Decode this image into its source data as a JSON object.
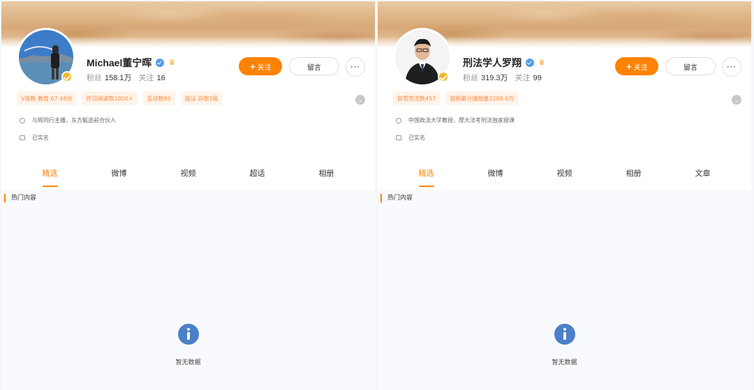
{
  "profiles": [
    {
      "name": "Michael董宁晖",
      "avatar_desc": "avatar",
      "stats": {
        "fans_label": "粉丝",
        "fans": "158.1万",
        "following_label": "关注",
        "following": "16"
      },
      "follow_label": "关注",
      "message_label": "留言",
      "more_label": "···",
      "tags": [
        "V指数 教育 67.48分",
        "昨日阅读数1000+",
        "互动数95",
        "超话 白银1级"
      ],
      "info": [
        "与辉同行主播，东方甄选前合伙人",
        "已实名"
      ],
      "tabs": [
        "精选",
        "微博",
        "视频",
        "超话",
        "相册"
      ],
      "active_tab": 0,
      "section_title": "热门内容",
      "empty_text": "暂无数据"
    },
    {
      "name": "刑法学人罗翔",
      "avatar_desc": "avatar",
      "stats": {
        "fans_label": "粉丝",
        "fans": "319.3万",
        "following_label": "关注",
        "following": "99"
      },
      "follow_label": "关注",
      "message_label": "留言",
      "more_label": "···",
      "tags": [
        "获赞赏次数457",
        "视频累计播放量3200.6万"
      ],
      "info": [
        "中国政法大学教授，厚大法考刑法独家授课",
        "已实名"
      ],
      "tabs": [
        "精选",
        "微博",
        "视频",
        "相册",
        "文章"
      ],
      "active_tab": 0,
      "section_title": "热门内容",
      "empty_text": "暂无数据"
    }
  ],
  "colors": {
    "accent": "#ff8200",
    "tag_bg": "#fff3ea",
    "tag_text": "#ff8a3d",
    "info_icon": "#4b80c8"
  }
}
